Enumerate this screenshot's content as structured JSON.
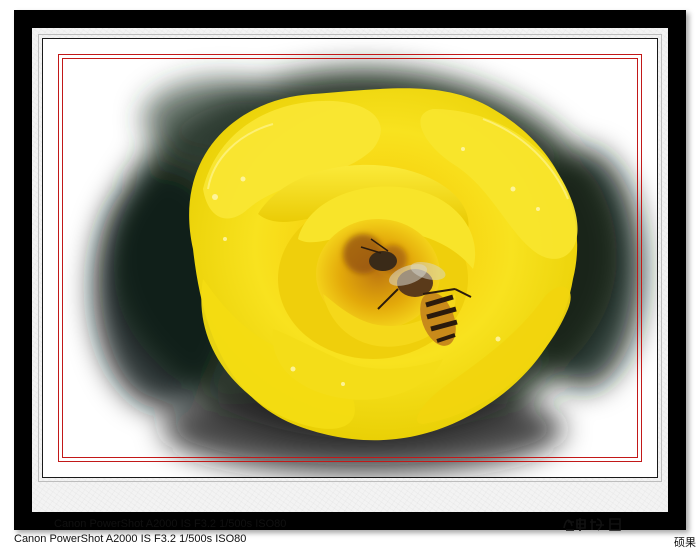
{
  "photo": {
    "subject": "yellow-rose-with-bee",
    "exif_caption": "Canon PowerShot A2000 IS F3.2 1/500s ISO80",
    "signature_text": "庭中晚日"
  },
  "footer": {
    "exif_caption": "Canon PowerShot A2000 IS F3.2 1/500s ISO80",
    "watermark": "硕果"
  },
  "colors": {
    "frame": "#000000",
    "mat": "#f3f3f3",
    "accent_line": "#c21818",
    "petal": "#f7e21a",
    "petal_shadow": "#d9b800",
    "foliage": "#1d2b22"
  }
}
